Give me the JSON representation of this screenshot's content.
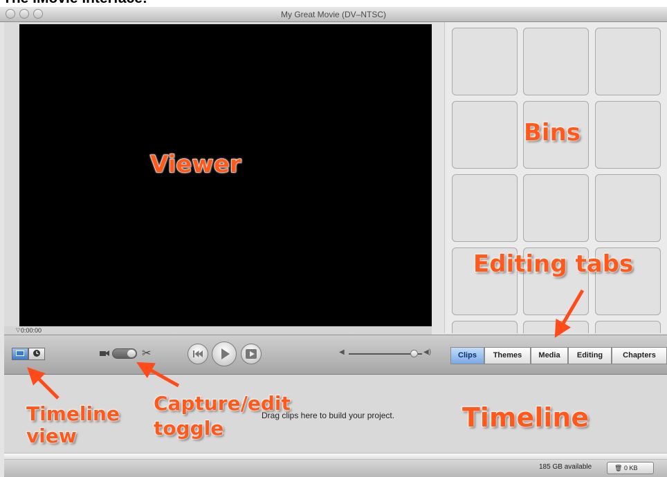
{
  "page": {
    "heading": "The iMovie interface:"
  },
  "window": {
    "title": "My Great Movie (DV–NTSC)"
  },
  "viewer": {
    "timecode": "0:00:00"
  },
  "tabs": [
    {
      "label": "Clips",
      "active": true
    },
    {
      "label": "Themes",
      "active": false
    },
    {
      "label": "Media",
      "active": false
    },
    {
      "label": "Editing",
      "active": false
    },
    {
      "label": "Chapters",
      "active": false
    }
  ],
  "timeline": {
    "hint": "Drag clips here to build your project."
  },
  "status": {
    "disk_space": "185 GB available",
    "trash_label": "0 KB"
  },
  "annotations": {
    "viewer": "Viewer",
    "bins": "Bins",
    "editing_tabs": "Editing tabs",
    "timeline_view": "Timeline view",
    "capture_edit_toggle": "Capture/edit toggle",
    "timeline": "Timeline"
  },
  "colors": {
    "annotation": "#ff5a1c",
    "active_tab": "#79a9e6"
  },
  "icons": {
    "clip_view": "clip-view-icon",
    "timeline_view": "clock-icon",
    "capture": "camera-icon",
    "edit": "scissors-icon",
    "rewind": "rewind-icon",
    "play": "play-icon",
    "play_full": "play-fullscreen-icon",
    "trash": "trash-icon"
  }
}
